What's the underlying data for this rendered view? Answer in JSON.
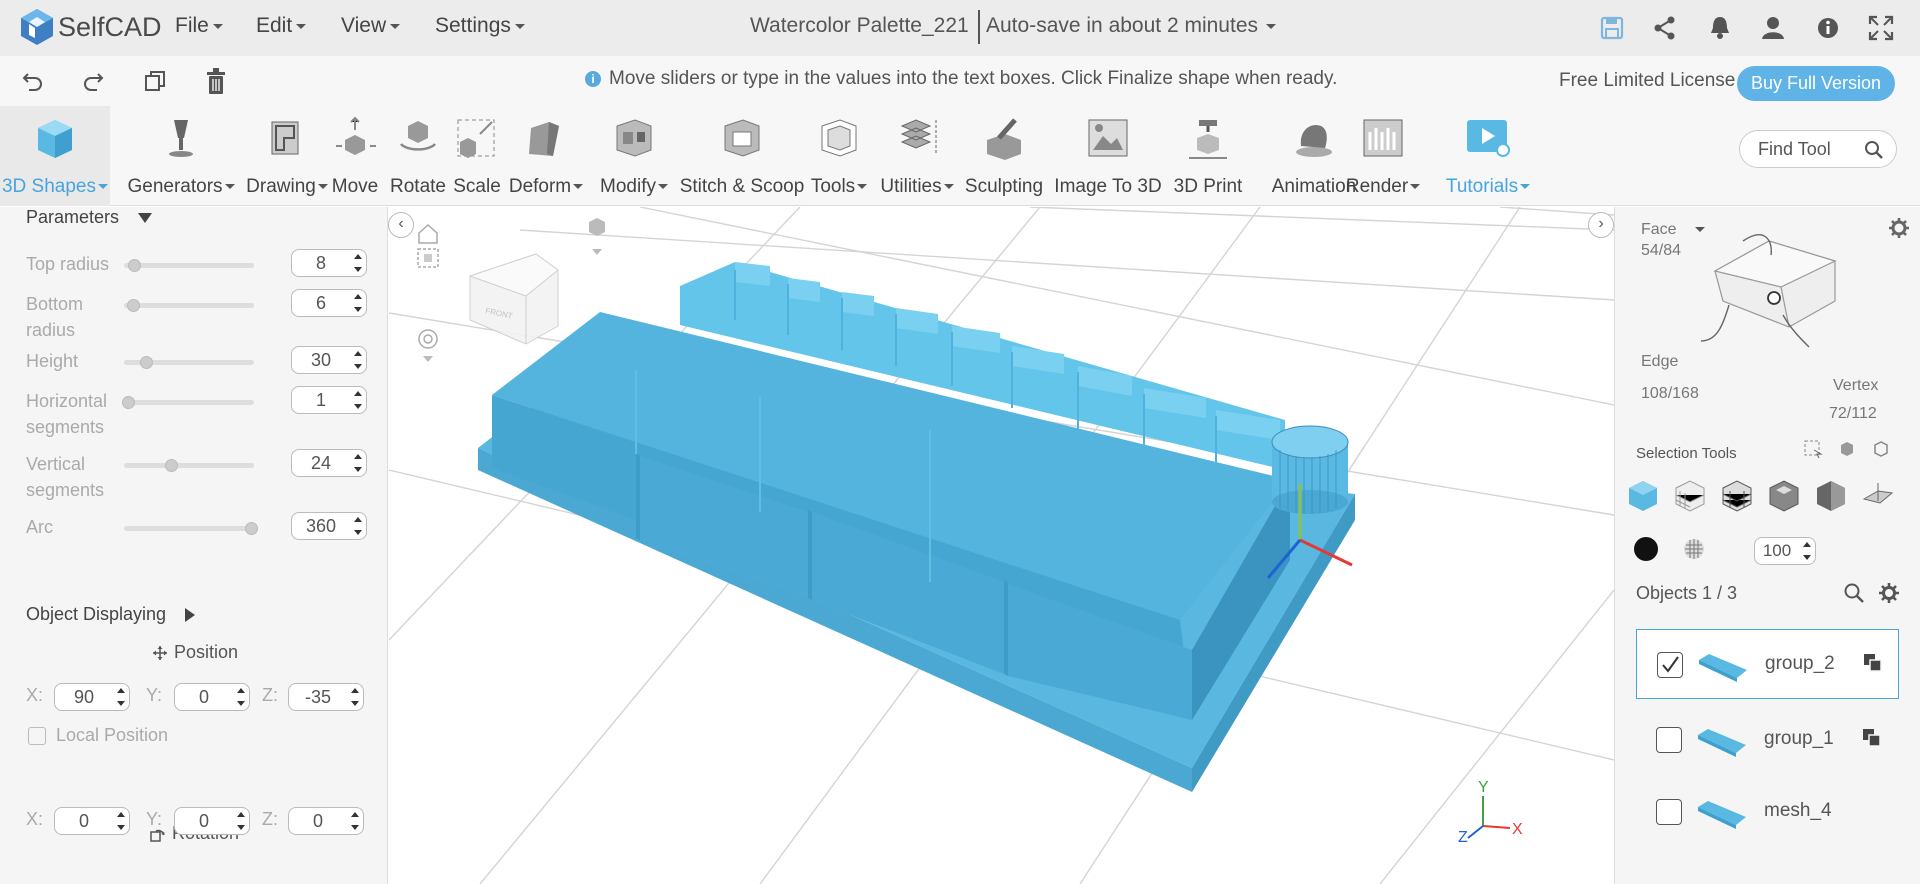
{
  "app": {
    "name": "SelfCAD"
  },
  "menu": {
    "file": "File",
    "edit": "Edit",
    "view": "View",
    "settings": "Settings"
  },
  "document": {
    "title": "Watercolor Palette_221",
    "autosave": "Auto-save in about 2 minutes"
  },
  "topicons": [
    "save-icon",
    "share-icon",
    "bell-icon",
    "user-icon",
    "info-icon",
    "fullscreen-icon"
  ],
  "hint": "Move sliders or type in the values into the text boxes. Click Finalize shape when ready.",
  "license": {
    "label": "Free Limited License",
    "buy": "Buy Full Version"
  },
  "tools": [
    {
      "label": "3D Shapes",
      "dropdown": true
    },
    {
      "label": "Generators",
      "dropdown": true
    },
    {
      "label": "Drawing",
      "dropdown": true
    },
    {
      "label": "Move",
      "dropdown": false
    },
    {
      "label": "Rotate",
      "dropdown": false
    },
    {
      "label": "Scale",
      "dropdown": false
    },
    {
      "label": "Deform",
      "dropdown": true
    },
    {
      "label": "Modify",
      "dropdown": true
    },
    {
      "label": "Stitch & Scoop",
      "dropdown": false
    },
    {
      "label": "Tools",
      "dropdown": true
    },
    {
      "label": "Utilities",
      "dropdown": true
    },
    {
      "label": "Sculpting",
      "dropdown": false
    },
    {
      "label": "Image To 3D",
      "dropdown": false
    },
    {
      "label": "3D Print",
      "dropdown": false
    },
    {
      "label": "Animation",
      "dropdown": false
    },
    {
      "label": "Render",
      "dropdown": true
    },
    {
      "label": "Tutorials",
      "dropdown": true
    }
  ],
  "find_tool": "Find Tool",
  "parameters": {
    "title": "Parameters",
    "rows": [
      {
        "label": "Top radius",
        "value": "8",
        "level": 0.05
      },
      {
        "label": "Bottom radius",
        "value": "6",
        "level": 0.04
      },
      {
        "label": "Height",
        "value": "30",
        "level": 0.15
      },
      {
        "label": "Horizontal segments",
        "value": "1",
        "level": 0.0
      },
      {
        "label": "Vertical segments",
        "value": "24",
        "level": 0.35
      },
      {
        "label": "Arc",
        "value": "360",
        "level": 1.0
      }
    ]
  },
  "object_displaying": {
    "title": "Object Displaying",
    "position_label": "Position",
    "position": {
      "x": "90",
      "y": "0",
      "z": "-35"
    },
    "local_position": "Local Position",
    "rotation_label": "Rotation",
    "rotation": {
      "x": "0",
      "y": "0",
      "z": "0"
    },
    "axes": {
      "x": "X:",
      "y": "Y:",
      "z": "Z:"
    }
  },
  "selection": {
    "face": "Face",
    "face_count": "54/84",
    "edge": "Edge",
    "edge_count": "108/168",
    "vertex": "Vertex",
    "vertex_count": "72/112",
    "tools_label": "Selection Tools",
    "opacity": "100"
  },
  "objects": {
    "label": "Objects 1 / 3",
    "items": [
      {
        "name": "group_2",
        "checked": true
      },
      {
        "name": "group_1",
        "checked": false
      },
      {
        "name": "mesh_4",
        "checked": false
      }
    ]
  },
  "viewport": {
    "axis_x": "X",
    "axis_y": "Y",
    "axis_z": "Z",
    "cube_face": "FRONT"
  },
  "colors": {
    "accent": "#47a4dc",
    "model": "#5bbfe6",
    "button": "#5fb3e6"
  }
}
